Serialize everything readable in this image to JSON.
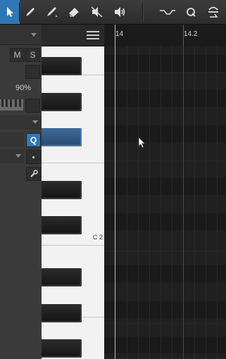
{
  "toolbar": {
    "tools": [
      {
        "name": "arrow-tool",
        "active": true
      },
      {
        "name": "pencil-tool",
        "active": false
      },
      {
        "name": "paint-tool",
        "active": false
      },
      {
        "name": "eraser-tool",
        "active": false
      },
      {
        "name": "mute-tool",
        "active": false
      },
      {
        "name": "listen-tool",
        "active": false
      },
      {
        "name": "bend-tool",
        "active": false
      },
      {
        "name": "quantize-tool",
        "active": false
      },
      {
        "name": "transpose-tool",
        "active": false
      }
    ]
  },
  "inspector": {
    "mute_label": "M",
    "solo_label": "S",
    "velocity_value": "90%",
    "quantize_label": "Q"
  },
  "piano": {
    "c_label": "C 2"
  },
  "ruler": {
    "labels": [
      "14",
      "14.2"
    ]
  },
  "colors": {
    "accent": "#2f78b7",
    "selected_key": "#3e6a95"
  }
}
